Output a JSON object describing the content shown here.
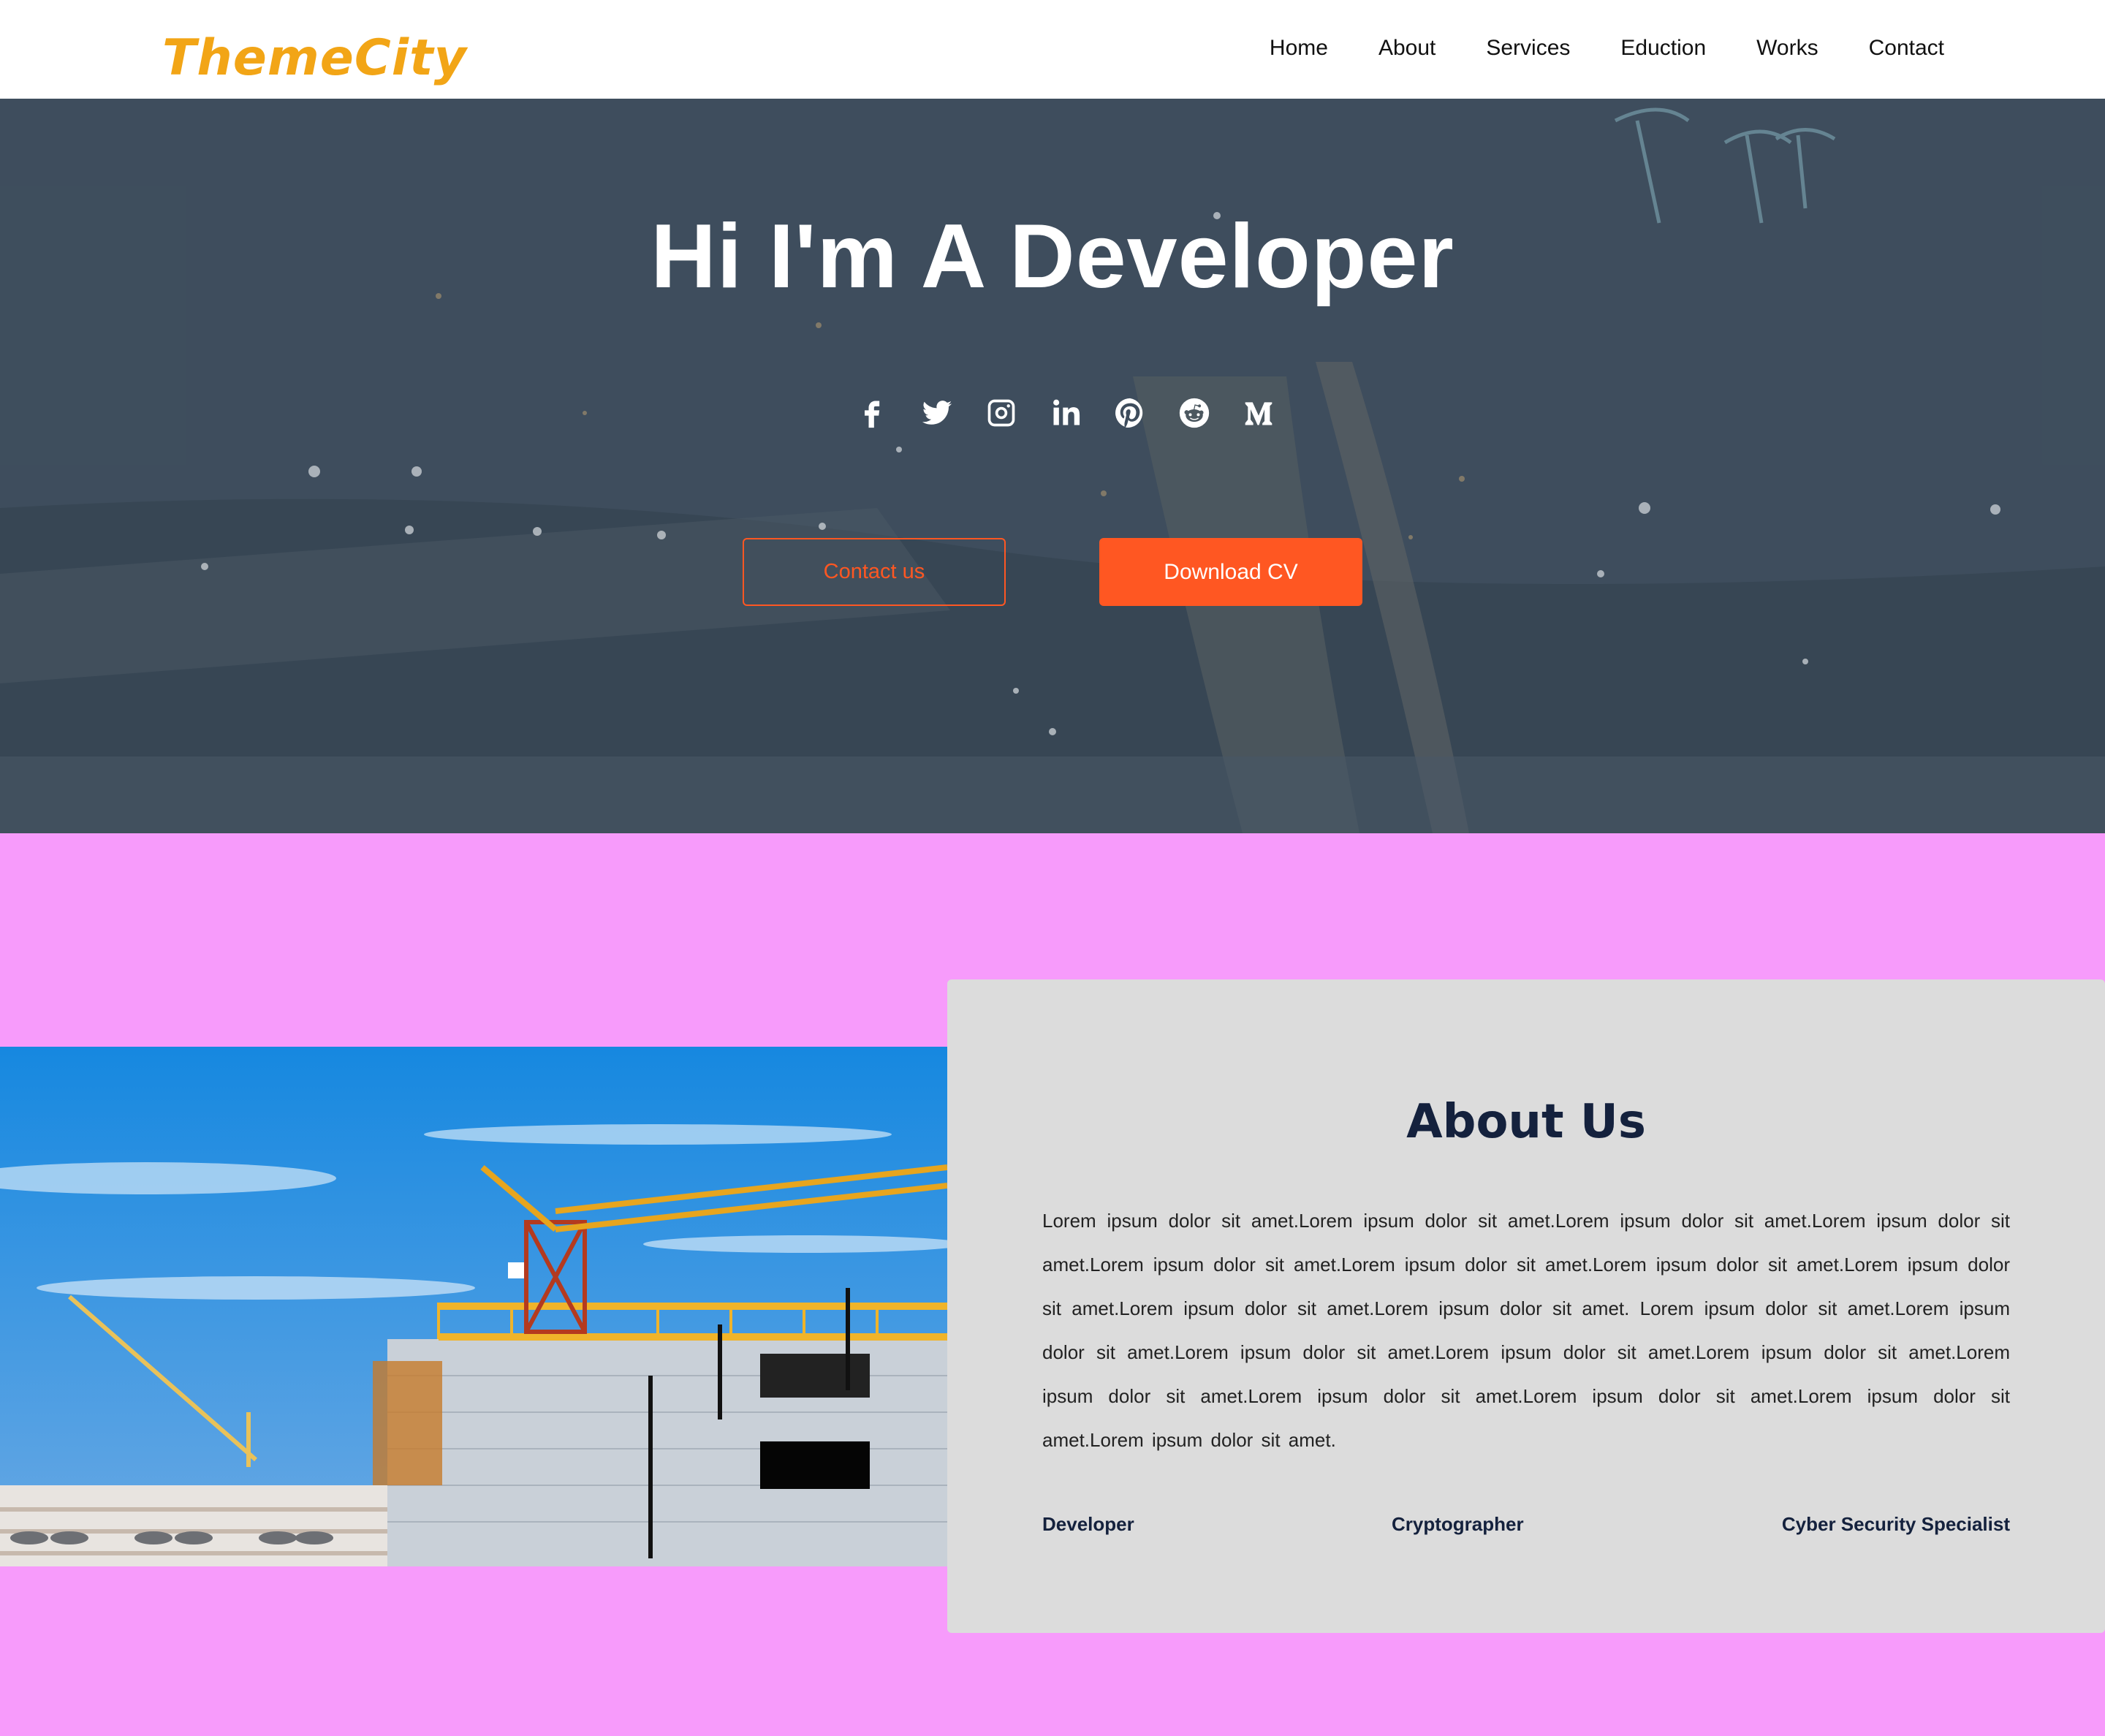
{
  "brand": {
    "logo": "ThemeCity",
    "logo_color": "#f2a516",
    "accent": "#ff5722"
  },
  "nav": {
    "items": [
      "Home",
      "About",
      "Services",
      "Eduction",
      "Works",
      "Contact"
    ]
  },
  "hero": {
    "title": "Hi I'm A Developer",
    "social_icons": [
      "facebook-icon",
      "twitter-icon",
      "instagram-icon",
      "linkedin-icon",
      "pinterest-icon",
      "reddit-icon",
      "medium-icon"
    ],
    "contact_button": "Contact us",
    "download_button": "Download CV"
  },
  "about": {
    "title": "About Us",
    "body": "Lorem ipsum dolor sit amet.Lorem ipsum dolor sit amet.Lorem ipsum dolor sit amet.Lorem ipsum dolor sit amet.Lorem ipsum dolor sit amet.Lorem ipsum dolor sit amet.Lorem ipsum dolor sit amet.Lorem ipsum dolor sit amet.Lorem ipsum dolor sit amet.Lorem ipsum dolor sit amet. Lorem ipsum dolor sit amet.Lorem ipsum dolor sit amet.Lorem ipsum dolor sit amet.Lorem ipsum dolor sit amet.Lorem ipsum dolor sit amet.Lorem ipsum dolor sit amet.Lorem ipsum dolor sit amet.Lorem ipsum dolor sit amet.Lorem ipsum dolor sit amet.Lorem ipsum dolor sit amet.",
    "roles": [
      "Developer",
      "Cryptographer",
      "Cyber Security Specialist"
    ],
    "background_color": "#f79bfb",
    "card_color": "#dcdcdc"
  }
}
